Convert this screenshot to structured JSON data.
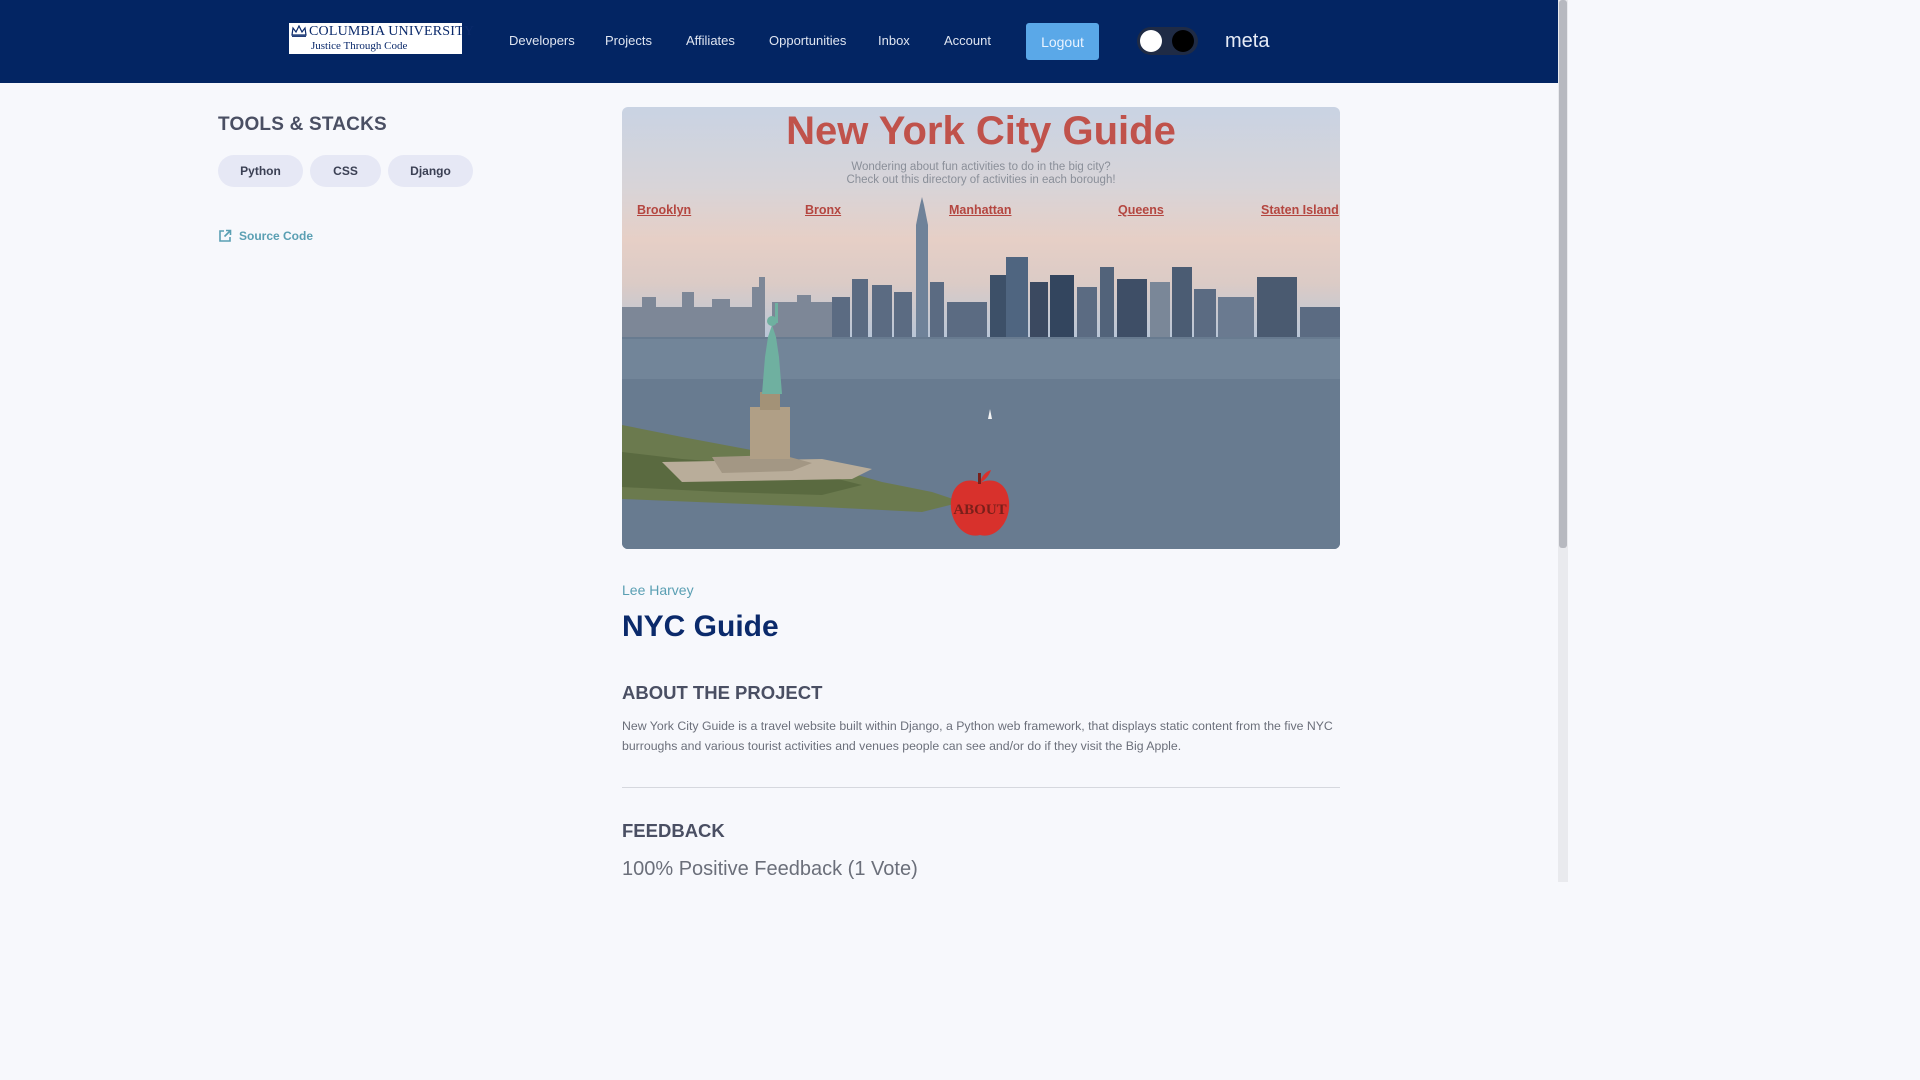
{
  "header": {
    "logo": {
      "line1": "COLUMBIA UNIVERSITY",
      "line2": "Justice Through Code"
    },
    "nav": [
      "Developers",
      "Projects",
      "Affiliates",
      "Opportunities",
      "Inbox",
      "Account"
    ],
    "logout_label": "Logout",
    "username": "meta"
  },
  "sidebar": {
    "tools_title": "TOOLS & STACKS",
    "tools": [
      "Python",
      "CSS",
      "Django"
    ],
    "source_label": "Source Code"
  },
  "hero": {
    "title": "New York City Guide",
    "subtitle_line1": "Wondering about fun activities to do in the big city?",
    "subtitle_line2": "Check out this directory of activities in each borough!",
    "boroughs": [
      "Brooklyn",
      "Bronx",
      "Manhattan",
      "Queens",
      "Staten Island"
    ],
    "about_badge": "ABOUT"
  },
  "project": {
    "author": "Lee Harvey",
    "title": "NYC Guide",
    "about_heading": "ABOUT THE PROJECT",
    "description": "New York City Guide is a travel website built within Django, a Python web framework, that displays static content from the five NYC burroughs and various tourist activities and venues people can see and/or do if they visit the Big Apple.",
    "feedback_heading": "FEEDBACK",
    "feedback_summary": "100% Positive Feedback (1 Vote)"
  },
  "colors": {
    "header_bg": "#032563",
    "accent_button": "#5aa8e8",
    "title_blue": "#0b2a6b",
    "link_teal": "#5a9fb3",
    "hero_red": "#c0524b"
  }
}
